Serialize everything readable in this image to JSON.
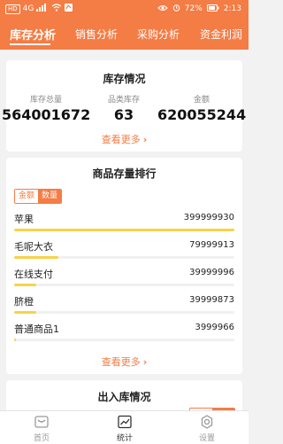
{
  "status_bar": {
    "left_chip": "HD",
    "signal": "4G",
    "battery_percent": "72%",
    "time": "2:13"
  },
  "tabs": [
    {
      "label": "库存分析",
      "active": true
    },
    {
      "label": "销售分析",
      "active": false
    },
    {
      "label": "采购分析",
      "active": false
    },
    {
      "label": "资金利润",
      "active": false
    }
  ],
  "inventory": {
    "title": "库存情况",
    "stats": [
      {
        "label": "库存总量",
        "value": "564001672"
      },
      {
        "label": "品类库存",
        "value": "63"
      },
      {
        "label": "金额",
        "value": "620055244"
      }
    ],
    "more_label": "查看更多"
  },
  "ranking": {
    "title": "商品存量排行",
    "toggle": {
      "left": "金额",
      "right": "数量",
      "selected": "数量"
    },
    "items": [
      {
        "name": "苹果",
        "value": "399999930",
        "ratio": 1.0
      },
      {
        "name": "毛呢大衣",
        "value": "79999913",
        "ratio": 0.2
      },
      {
        "name": "在线支付",
        "value": "39999996",
        "ratio": 0.1
      },
      {
        "name": "脐橙",
        "value": "39999873",
        "ratio": 0.1
      },
      {
        "name": "普通商品1",
        "value": "3999966",
        "ratio": 0.01
      }
    ],
    "more_label": "查看更多"
  },
  "in_out": {
    "title": "出入库情况"
  },
  "bottom_nav": [
    {
      "label": "首页",
      "icon": "home-icon",
      "active": false
    },
    {
      "label": "统计",
      "icon": "chart-icon",
      "active": true
    },
    {
      "label": "设置",
      "icon": "settings-icon",
      "active": false
    }
  ],
  "colors": {
    "accent": "#f47c45",
    "bar": "#f8d34a",
    "background": "#f2f2f2"
  }
}
